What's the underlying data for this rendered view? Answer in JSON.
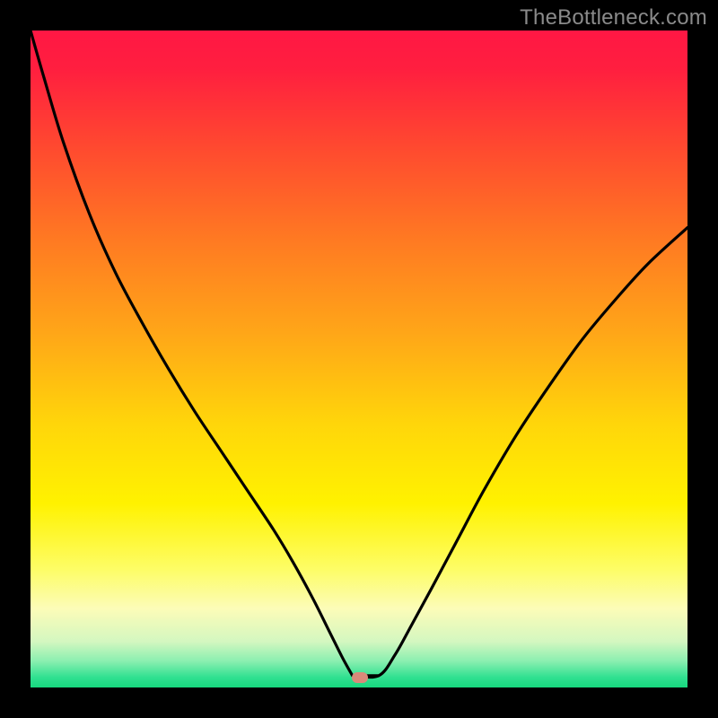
{
  "watermark": "TheBottleneck.com",
  "marker": {
    "x_frac": 0.502,
    "y_frac": 0.985
  },
  "gradient_stops": [
    {
      "offset": 0.0,
      "color": "#ff1744"
    },
    {
      "offset": 0.06,
      "color": "#ff1f3f"
    },
    {
      "offset": 0.18,
      "color": "#ff4a2f"
    },
    {
      "offset": 0.32,
      "color": "#ff7a22"
    },
    {
      "offset": 0.46,
      "color": "#ffa618"
    },
    {
      "offset": 0.6,
      "color": "#ffd60a"
    },
    {
      "offset": 0.72,
      "color": "#fff200"
    },
    {
      "offset": 0.82,
      "color": "#fdfd66"
    },
    {
      "offset": 0.88,
      "color": "#fcfcb8"
    },
    {
      "offset": 0.93,
      "color": "#d4f7c0"
    },
    {
      "offset": 0.96,
      "color": "#8aefb0"
    },
    {
      "offset": 0.985,
      "color": "#2fe090"
    },
    {
      "offset": 1.0,
      "color": "#17d87e"
    }
  ],
  "chart_data": {
    "type": "line",
    "title": "",
    "xlabel": "",
    "ylabel": "",
    "xlim": [
      0,
      1
    ],
    "ylim": [
      0,
      1
    ],
    "series": [
      {
        "name": "bottleneck-curve",
        "x": [
          0.0,
          0.02,
          0.05,
          0.09,
          0.13,
          0.17,
          0.21,
          0.25,
          0.29,
          0.33,
          0.37,
          0.4,
          0.43,
          0.455,
          0.475,
          0.49,
          0.53,
          0.555,
          0.58,
          0.61,
          0.65,
          0.69,
          0.74,
          0.79,
          0.84,
          0.89,
          0.94,
          1.0
        ],
        "y": [
          1.0,
          0.93,
          0.83,
          0.72,
          0.63,
          0.555,
          0.485,
          0.42,
          0.36,
          0.3,
          0.24,
          0.19,
          0.135,
          0.085,
          0.045,
          0.018,
          0.018,
          0.05,
          0.095,
          0.15,
          0.225,
          0.3,
          0.385,
          0.46,
          0.53,
          0.59,
          0.645,
          0.7
        ]
      }
    ],
    "marker_point": {
      "x": 0.502,
      "y": 0.015
    },
    "annotations": []
  }
}
